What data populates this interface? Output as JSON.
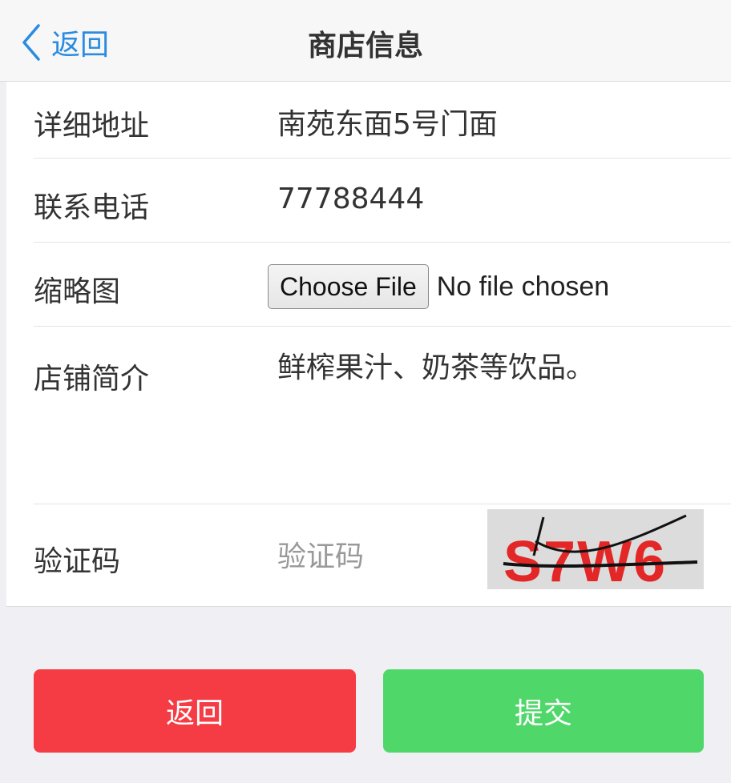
{
  "header": {
    "back_label": "返回",
    "title": "商店信息"
  },
  "form": {
    "address": {
      "label": "详细地址",
      "value": "南苑东面5号门面"
    },
    "phone": {
      "label": "联系电话",
      "value": "77788444"
    },
    "thumbnail": {
      "label": "缩略图",
      "button_label": "Choose File",
      "status": "No file chosen"
    },
    "intro": {
      "label": "店铺简介",
      "value": "鲜榨果汁、奶茶等饮品。"
    },
    "captcha": {
      "label": "验证码",
      "placeholder": "验证码",
      "image_text": "S7W6"
    }
  },
  "actions": {
    "back_label": "返回",
    "submit_label": "提交"
  },
  "colors": {
    "link": "#2a8ce0",
    "back_button": "#f53c45",
    "submit_button": "#50d76a",
    "captcha_text": "#e32626"
  }
}
